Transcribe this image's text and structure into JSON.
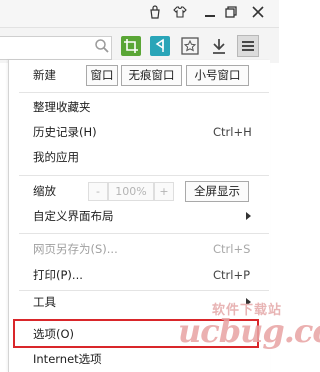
{
  "toolbar": {
    "icons": [
      "search-icon",
      "screenshot-icon",
      "share-icon",
      "bookmark-star-icon",
      "download-icon",
      "menu-icon"
    ],
    "accent_green": "#5aa636",
    "accent_teal": "#2aa5b8"
  },
  "menu": {
    "new_label": "新建",
    "new_window": "窗口",
    "incognito_window": "无痕窗口",
    "small_window": "小号窗口",
    "organize_bookmarks": "整理收藏夹",
    "history": "历史记录(H)",
    "history_shortcut": "Ctrl+H",
    "my_apps": "我的应用",
    "zoom_label": "缩放",
    "zoom_minus": "-",
    "zoom_value": "100%",
    "zoom_plus": "+",
    "fullscreen": "全屏显示",
    "customize_layout": "自定义界面布局",
    "save_as": "网页另存为(S)...",
    "save_as_shortcut": "Ctrl+S",
    "print": "打印(P)...",
    "print_shortcut": "Ctrl+P",
    "tools": "工具",
    "options": "选项(O)",
    "internet_options": "Internet选项"
  },
  "watermark": {
    "text": "软件下载站",
    "logo": "ucbug.cc"
  },
  "highlight_color": "#d9262a"
}
